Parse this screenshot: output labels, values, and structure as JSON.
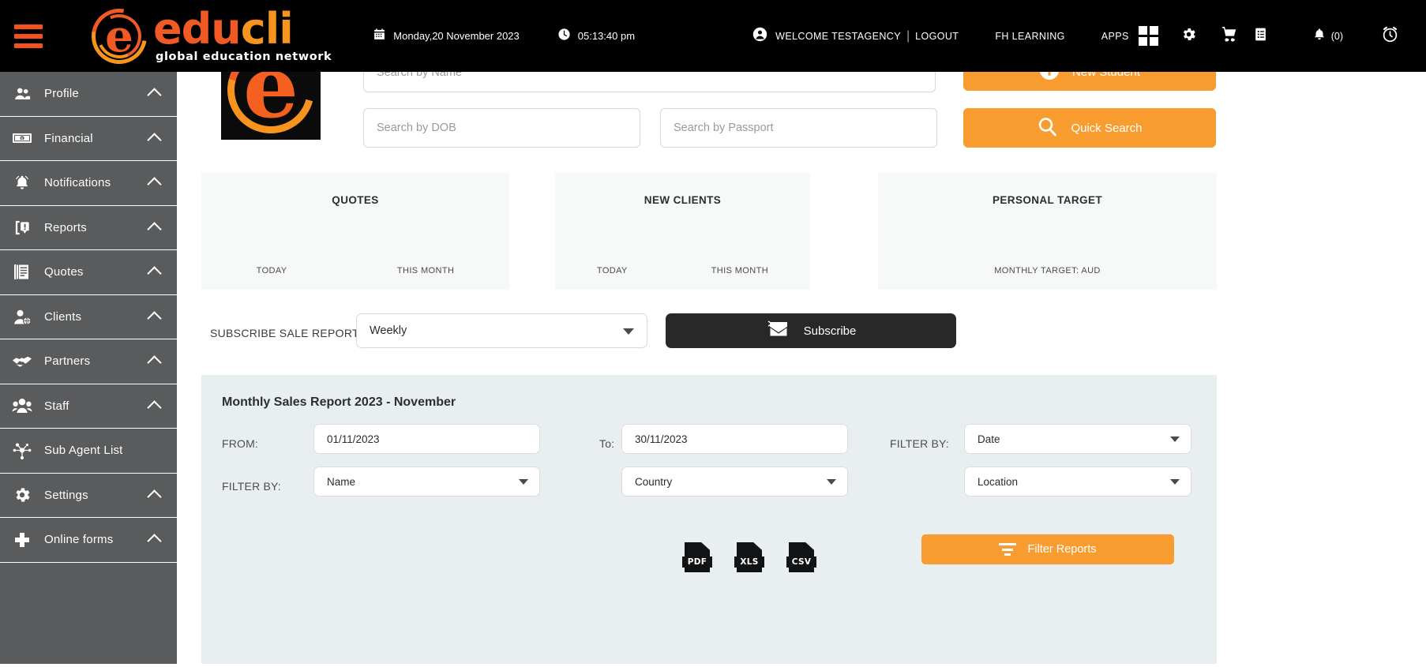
{
  "brand": {
    "logo_text_1": "edu",
    "logo_text_2": "cli",
    "tagline": "global education network"
  },
  "topbar": {
    "date": "Monday,20 November 2023",
    "time": "05:13:40 pm",
    "welcome": "WELCOME TESTAGENCY",
    "separator": "|",
    "logout": "LOGOUT",
    "fh_learning": "FH LEARNING",
    "apps": "APPS",
    "notification_count": "(0)"
  },
  "sidebar": {
    "items": [
      {
        "label": "Profile",
        "icon": "users-icon",
        "chevron": true
      },
      {
        "label": "Financial",
        "icon": "money-icon",
        "chevron": true
      },
      {
        "label": "Notifications",
        "icon": "bell-icon",
        "chevron": true
      },
      {
        "label": "Reports",
        "icon": "report-icon",
        "chevron": true
      },
      {
        "label": "Quotes",
        "icon": "documents-icon",
        "chevron": true
      },
      {
        "label": "Clients",
        "icon": "client-globe-icon",
        "chevron": true
      },
      {
        "label": "Partners",
        "icon": "handshake-icon",
        "chevron": true
      },
      {
        "label": "Staff",
        "icon": "staff-icon",
        "chevron": true
      },
      {
        "label": "Sub Agent List",
        "icon": "network-icon",
        "chevron": false
      },
      {
        "label": "Settings",
        "icon": "gear-icon",
        "chevron": true
      },
      {
        "label": "Online forms",
        "icon": "plus-icon",
        "chevron": true
      }
    ]
  },
  "search": {
    "name_placeholder": "Search by Name",
    "name_value": "",
    "dob_placeholder": "Search by DOB",
    "dob_value": "",
    "passport_placeholder": "Search by Passport",
    "passport_value": "",
    "new_student_label": "New Student",
    "quick_search_label": "Quick Search"
  },
  "cards": [
    {
      "title": "QUOTES",
      "foot": [
        "TODAY",
        "THIS MONTH"
      ]
    },
    {
      "title": "NEW CLIENTS",
      "foot": [
        "TODAY",
        "THIS MONTH"
      ]
    },
    {
      "title": "PERSONAL TARGET",
      "foot": [
        "MONTHLY TARGET: AUD"
      ]
    }
  ],
  "subscribe": {
    "label": "SUBSCRIBE SALE REPORT BY:",
    "period_value": "Weekly",
    "button_label": "Subscribe"
  },
  "report": {
    "title": "Monthly Sales Report 2023 - November",
    "from_label": "FROM:",
    "from_value": "01/11/2023",
    "to_label": "To:",
    "to_value": "30/11/2023",
    "filter_by_label_1": "FILTER BY:",
    "filter_date_value": "Date",
    "filter_by_label_2": "FILTER BY:",
    "filter_name_value": "Name",
    "filter_country_value": "Country",
    "filter_location_value": "Location",
    "export": [
      {
        "code": "PDF"
      },
      {
        "code": "XLS"
      },
      {
        "code": "CSV"
      }
    ],
    "filter_button_label": "Filter Reports"
  },
  "colors": {
    "accent_orange": "#f89c30",
    "brand_orange": "#f15a24",
    "brand_amber": "#f7941e",
    "sidebar": "#5a5b5c",
    "panel": "#e9eef1",
    "card": "#f7f8f8",
    "dark": "#282829"
  }
}
